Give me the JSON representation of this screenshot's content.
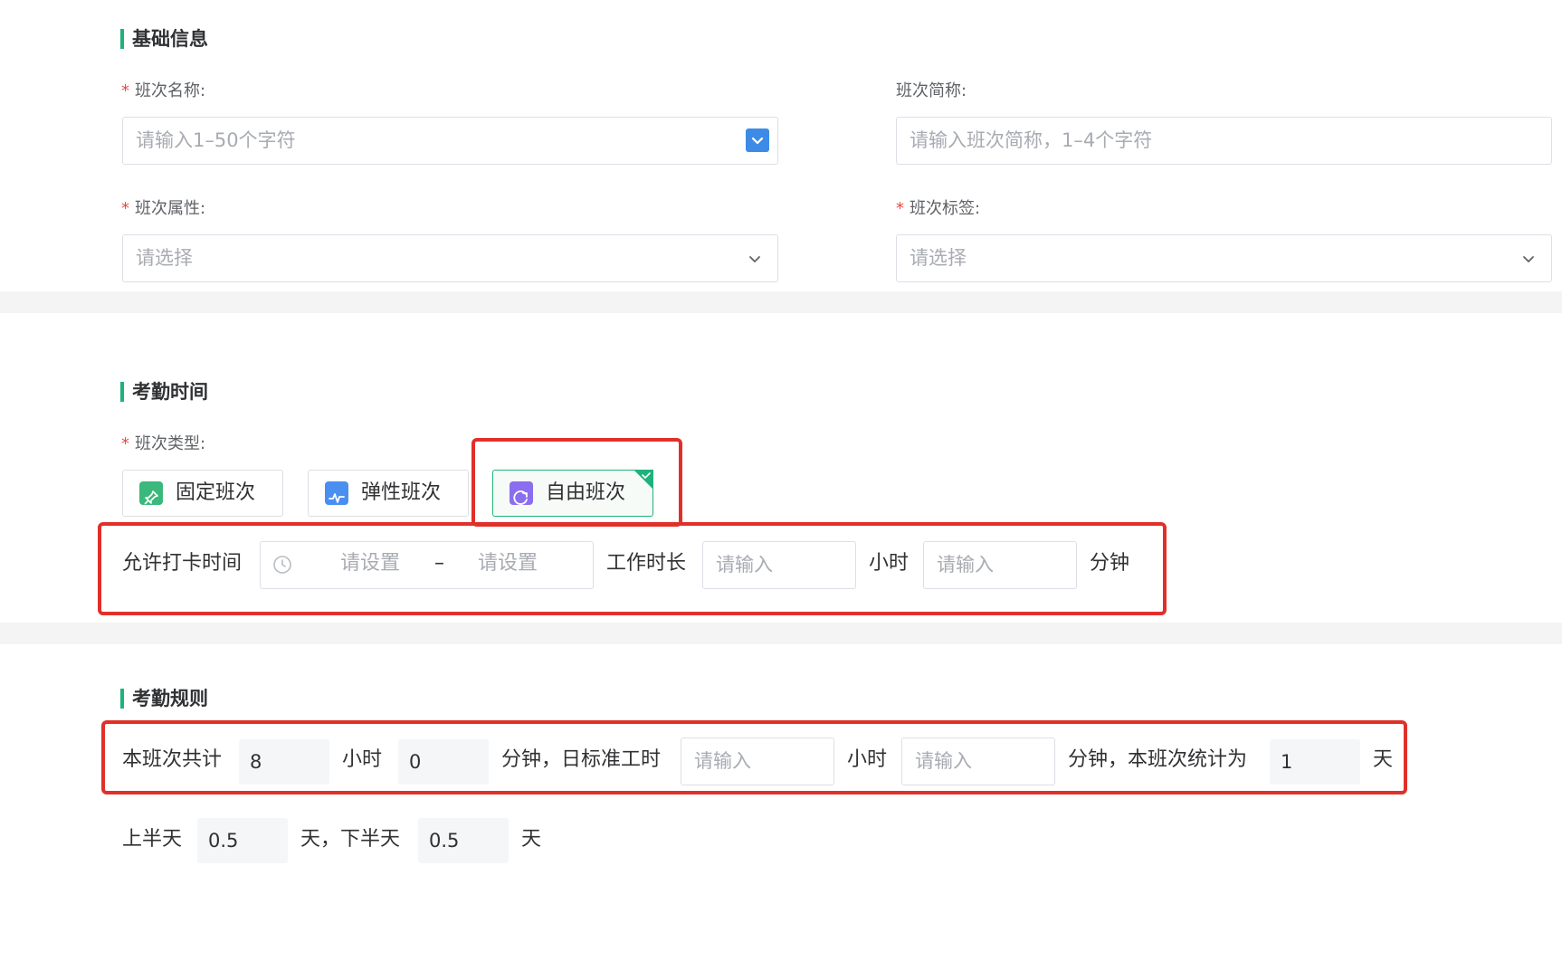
{
  "basic": {
    "title": "基础信息",
    "shift_name": {
      "label": "班次名称:",
      "placeholder": "请输入1–50个字符"
    },
    "shift_short": {
      "label": "班次简称:",
      "placeholder": "请输入班次简称，1–4个字符"
    },
    "shift_attr": {
      "label": "班次属性:",
      "placeholder": "请选择"
    },
    "shift_tag": {
      "label": "班次标签:",
      "placeholder": "请选择"
    },
    "required_mark": "*"
  },
  "attendance_time": {
    "title": "考勤时间",
    "shift_type_label": "班次类型:",
    "types": [
      {
        "label": "固定班次",
        "color": "#3bb87b",
        "icon": "pin-icon"
      },
      {
        "label": "弹性班次",
        "color": "#4a8ff0",
        "icon": "pulse-icon"
      },
      {
        "label": "自由班次",
        "color": "#8b6ef0",
        "icon": "refresh-icon"
      }
    ],
    "selected_type": "自由班次",
    "punch_label": "允许打卡时间",
    "punch_start_placeholder": "请设置",
    "punch_separator": "–",
    "punch_end_placeholder": "请设置",
    "work_duration_label": "工作时长",
    "hours_placeholder": "请输入",
    "hours_unit": "小时",
    "minutes_placeholder": "请输入",
    "minutes_unit": "分钟"
  },
  "attendance_rules": {
    "title": "考勤规则",
    "total_prefix": "本班次共计",
    "total_hours": "8",
    "hours_unit": "小时",
    "total_minutes": "0",
    "mid_text": "分钟，日标准工时",
    "std_hours_placeholder": "请输入",
    "std_hours_unit": "小时",
    "std_minutes_placeholder": "请输入",
    "count_text": "分钟，本班次统计为",
    "count_days": "1",
    "days_unit": "天",
    "first_half_label": "上半天",
    "first_half_value": "0.5",
    "second_half_text": "天，下半天",
    "second_half_value": "0.5",
    "second_half_unit": "天"
  },
  "colors": {
    "accent_green": "#1fb27b",
    "highlight_red": "#e0302a",
    "dropdown_blue": "#3c8ce7",
    "required_red": "#e34d43"
  }
}
